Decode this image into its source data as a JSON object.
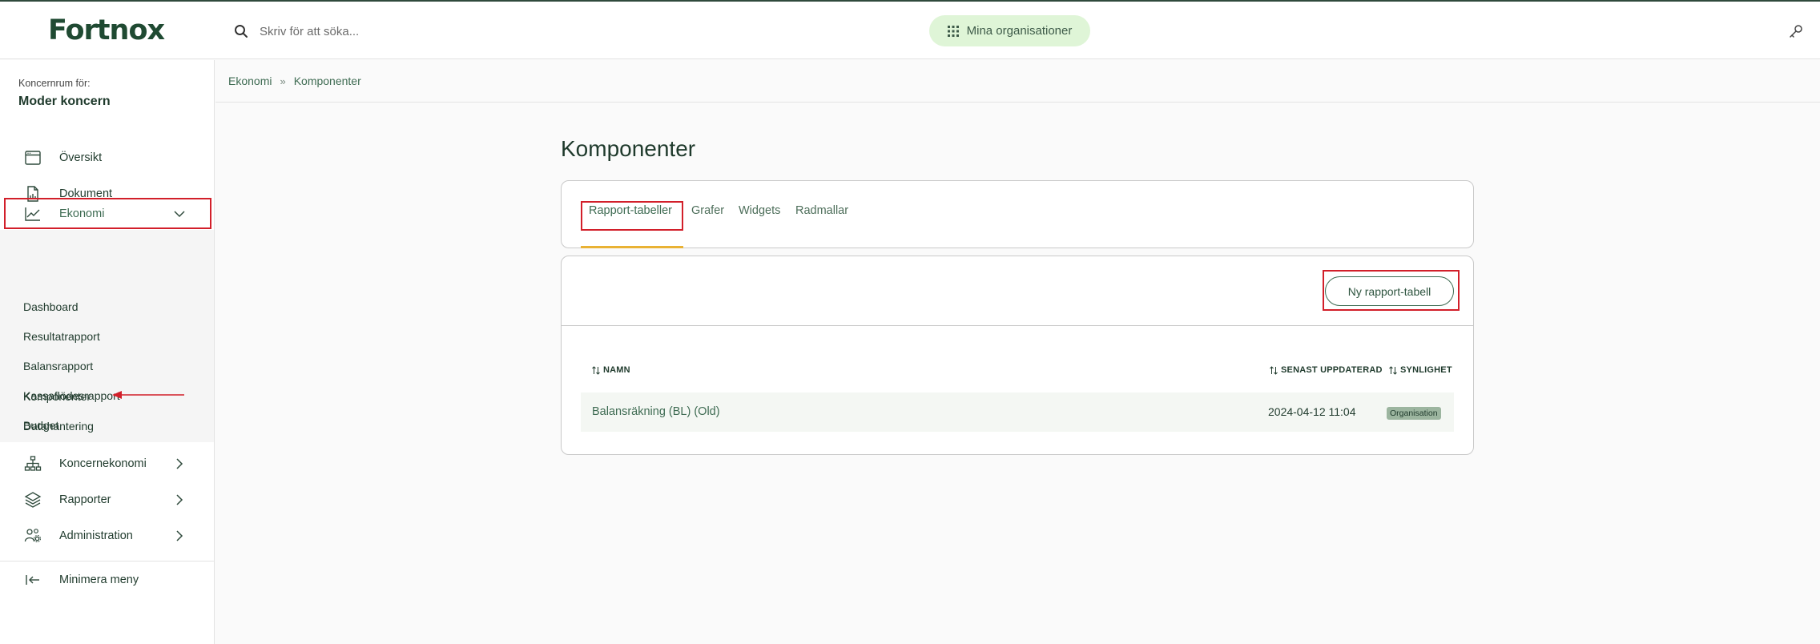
{
  "header": {
    "logo": "Fortnox",
    "search_placeholder": "Skriv för att söka...",
    "org_button_label": "Mina organisationer"
  },
  "sidebar": {
    "org_label": "Koncernrum för:",
    "org_name": "Moder koncern",
    "items": [
      {
        "label": "Översikt",
        "icon": "browser-window-icon"
      },
      {
        "label": "Dokument",
        "icon": "document-icon"
      },
      {
        "label": "Ekonomi",
        "icon": "line-chart-icon",
        "expanded": true
      },
      {
        "label": "Koncernekonomi",
        "icon": "hierarchy-icon"
      },
      {
        "label": "Rapporter",
        "icon": "layers-icon"
      },
      {
        "label": "Administration",
        "icon": "users-gear-icon"
      }
    ],
    "submenu": [
      "Dashboard",
      "Resultatrapport",
      "Balansrapport",
      "Kassaflödesrapport",
      "Budget",
      "Komponenter",
      "Datahantering"
    ],
    "minimize_label": "Minimera meny"
  },
  "breadcrumb": {
    "parent": "Ekonomi",
    "separator": "»",
    "current": "Komponenter"
  },
  "page": {
    "title": "Komponenter",
    "tabs": [
      "Rapport-tabeller",
      "Grafer",
      "Widgets",
      "Radmallar"
    ],
    "active_tab": "Rapport-tabeller",
    "new_button_label": "Ny rapport-tabell"
  },
  "table": {
    "columns": [
      "NAMN",
      "SENAST UPPDATERAD",
      "SYNLIGHET"
    ],
    "rows": [
      {
        "name": "Balansräkning (BL) (Old)",
        "updated": "2024-04-12 11:04",
        "visibility": "Organisation"
      }
    ]
  },
  "colors": {
    "brand": "#1f4a32",
    "accent_green": "#dff5d7",
    "highlight_red": "#d21f2a",
    "tab_underline": "#e9b234"
  }
}
